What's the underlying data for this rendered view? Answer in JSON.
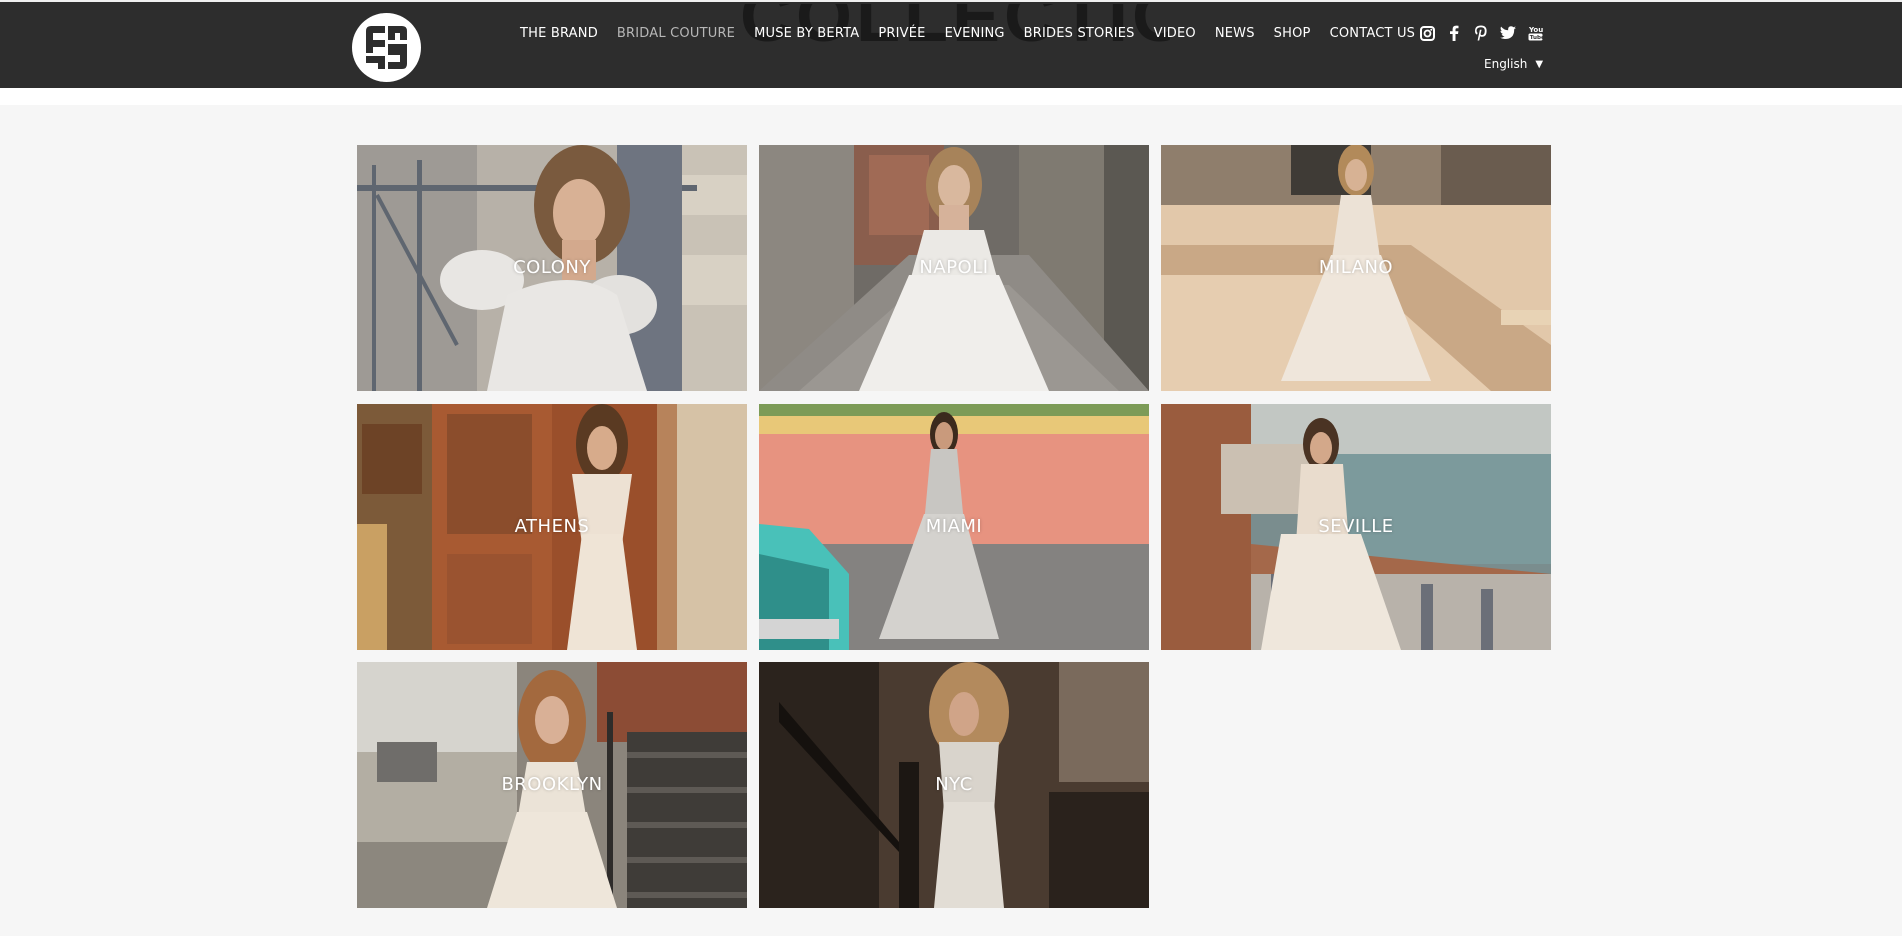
{
  "header": {
    "ghost_title": "COLLECTIONS",
    "nav": [
      {
        "label": "THE BRAND"
      },
      {
        "label": "BRIDAL COUTURE",
        "active": true
      },
      {
        "label": "MUSE BY BERTA"
      },
      {
        "label": "PRIVÉE"
      },
      {
        "label": "EVENING"
      },
      {
        "label": "BRIDES STORIES"
      },
      {
        "label": "VIDEO"
      },
      {
        "label": "NEWS"
      },
      {
        "label": "SHOP"
      },
      {
        "label": "CONTACT US"
      }
    ],
    "social": [
      "instagram-icon",
      "facebook-icon",
      "pinterest-icon",
      "twitter-icon",
      "youtube-icon"
    ],
    "language": "English"
  },
  "collections": [
    {
      "label": "COLONY"
    },
    {
      "label": "NAPOLI"
    },
    {
      "label": "MILANO"
    },
    {
      "label": "ATHENS"
    },
    {
      "label": "MIAMI"
    },
    {
      "label": "SEVILLE"
    },
    {
      "label": "BROOKLYN"
    },
    {
      "label": "NYC"
    }
  ],
  "colors": {
    "header_bg": "#2d2d2d",
    "page_bg": "#f6f6f6",
    "nav_active": "#b7b7b7"
  }
}
